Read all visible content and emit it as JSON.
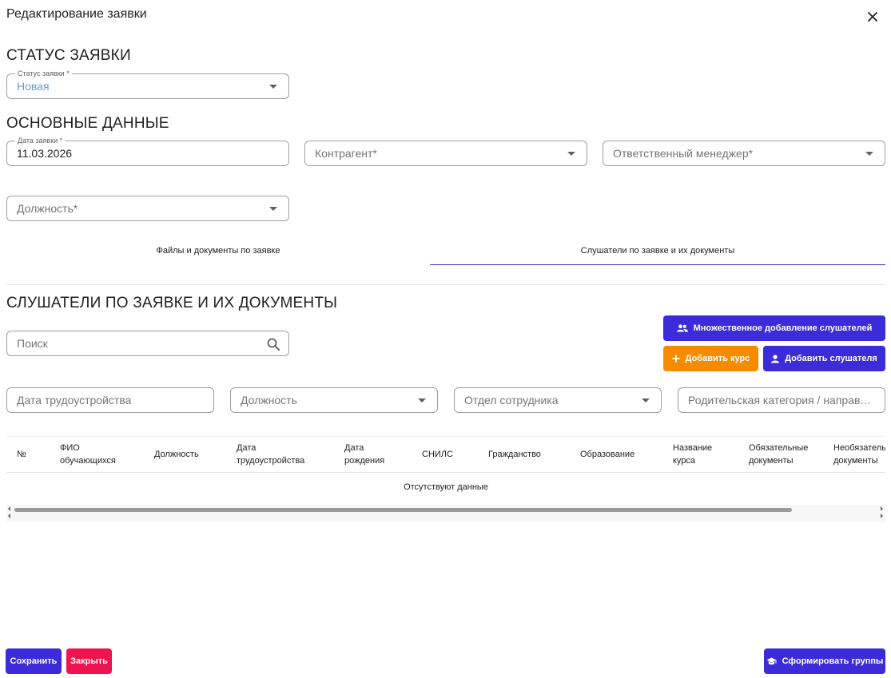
{
  "dialog": {
    "title": "Редактирование заявки",
    "close_icon": "close-icon"
  },
  "status_section": {
    "heading": "СТАТУС ЗАЯВКИ",
    "status_field": {
      "label": "Статус заявки *",
      "value": "Новая"
    }
  },
  "main_section": {
    "heading": "ОСНОВНЫЕ ДАННЫЕ",
    "date_field": {
      "label": "Дата заявки *",
      "value": "11.03.2026"
    },
    "counterparty_placeholder": "Контрагент*",
    "manager_placeholder": "Ответственный менеджер*",
    "position_placeholder": "Должность*"
  },
  "tabs": [
    {
      "label": "Файлы и документы по заявке",
      "active": false
    },
    {
      "label": "Слушатели по заявке и их документы",
      "active": true
    }
  ],
  "listeners_section": {
    "heading": "СЛУШАТЕЛИ ПО ЗАЯВКЕ И ИХ ДОКУМЕНТЫ",
    "search_placeholder": "Поиск",
    "buttons": {
      "bulk_add": "Множественное добавление слушателей",
      "add_course": "Добавить курс",
      "add_listener": "Добавить слушателя"
    },
    "filters": {
      "employment_date": "Дата трудоустройства",
      "position": "Должность",
      "department": "Отдел сотрудника",
      "parent_category": "Родительская категория / направление"
    },
    "table": {
      "columns": [
        "№",
        "ФИО обучающихся",
        "Должность",
        "Дата трудоустройства",
        "Дата рождения",
        "СНИЛС",
        "Гражданство",
        "Образование",
        "Название курса",
        "Обязательные документы",
        "Необязательные документы"
      ],
      "empty_text": "Отсутствуют данные"
    }
  },
  "footer": {
    "save": "Сохранить",
    "close": "Закрыть",
    "form_groups": "Сформировать группы"
  },
  "colors": {
    "primary": "#3b2bd9",
    "orange": "#f78b00",
    "danger": "#f0134d",
    "status_value": "#6b9ad1"
  }
}
